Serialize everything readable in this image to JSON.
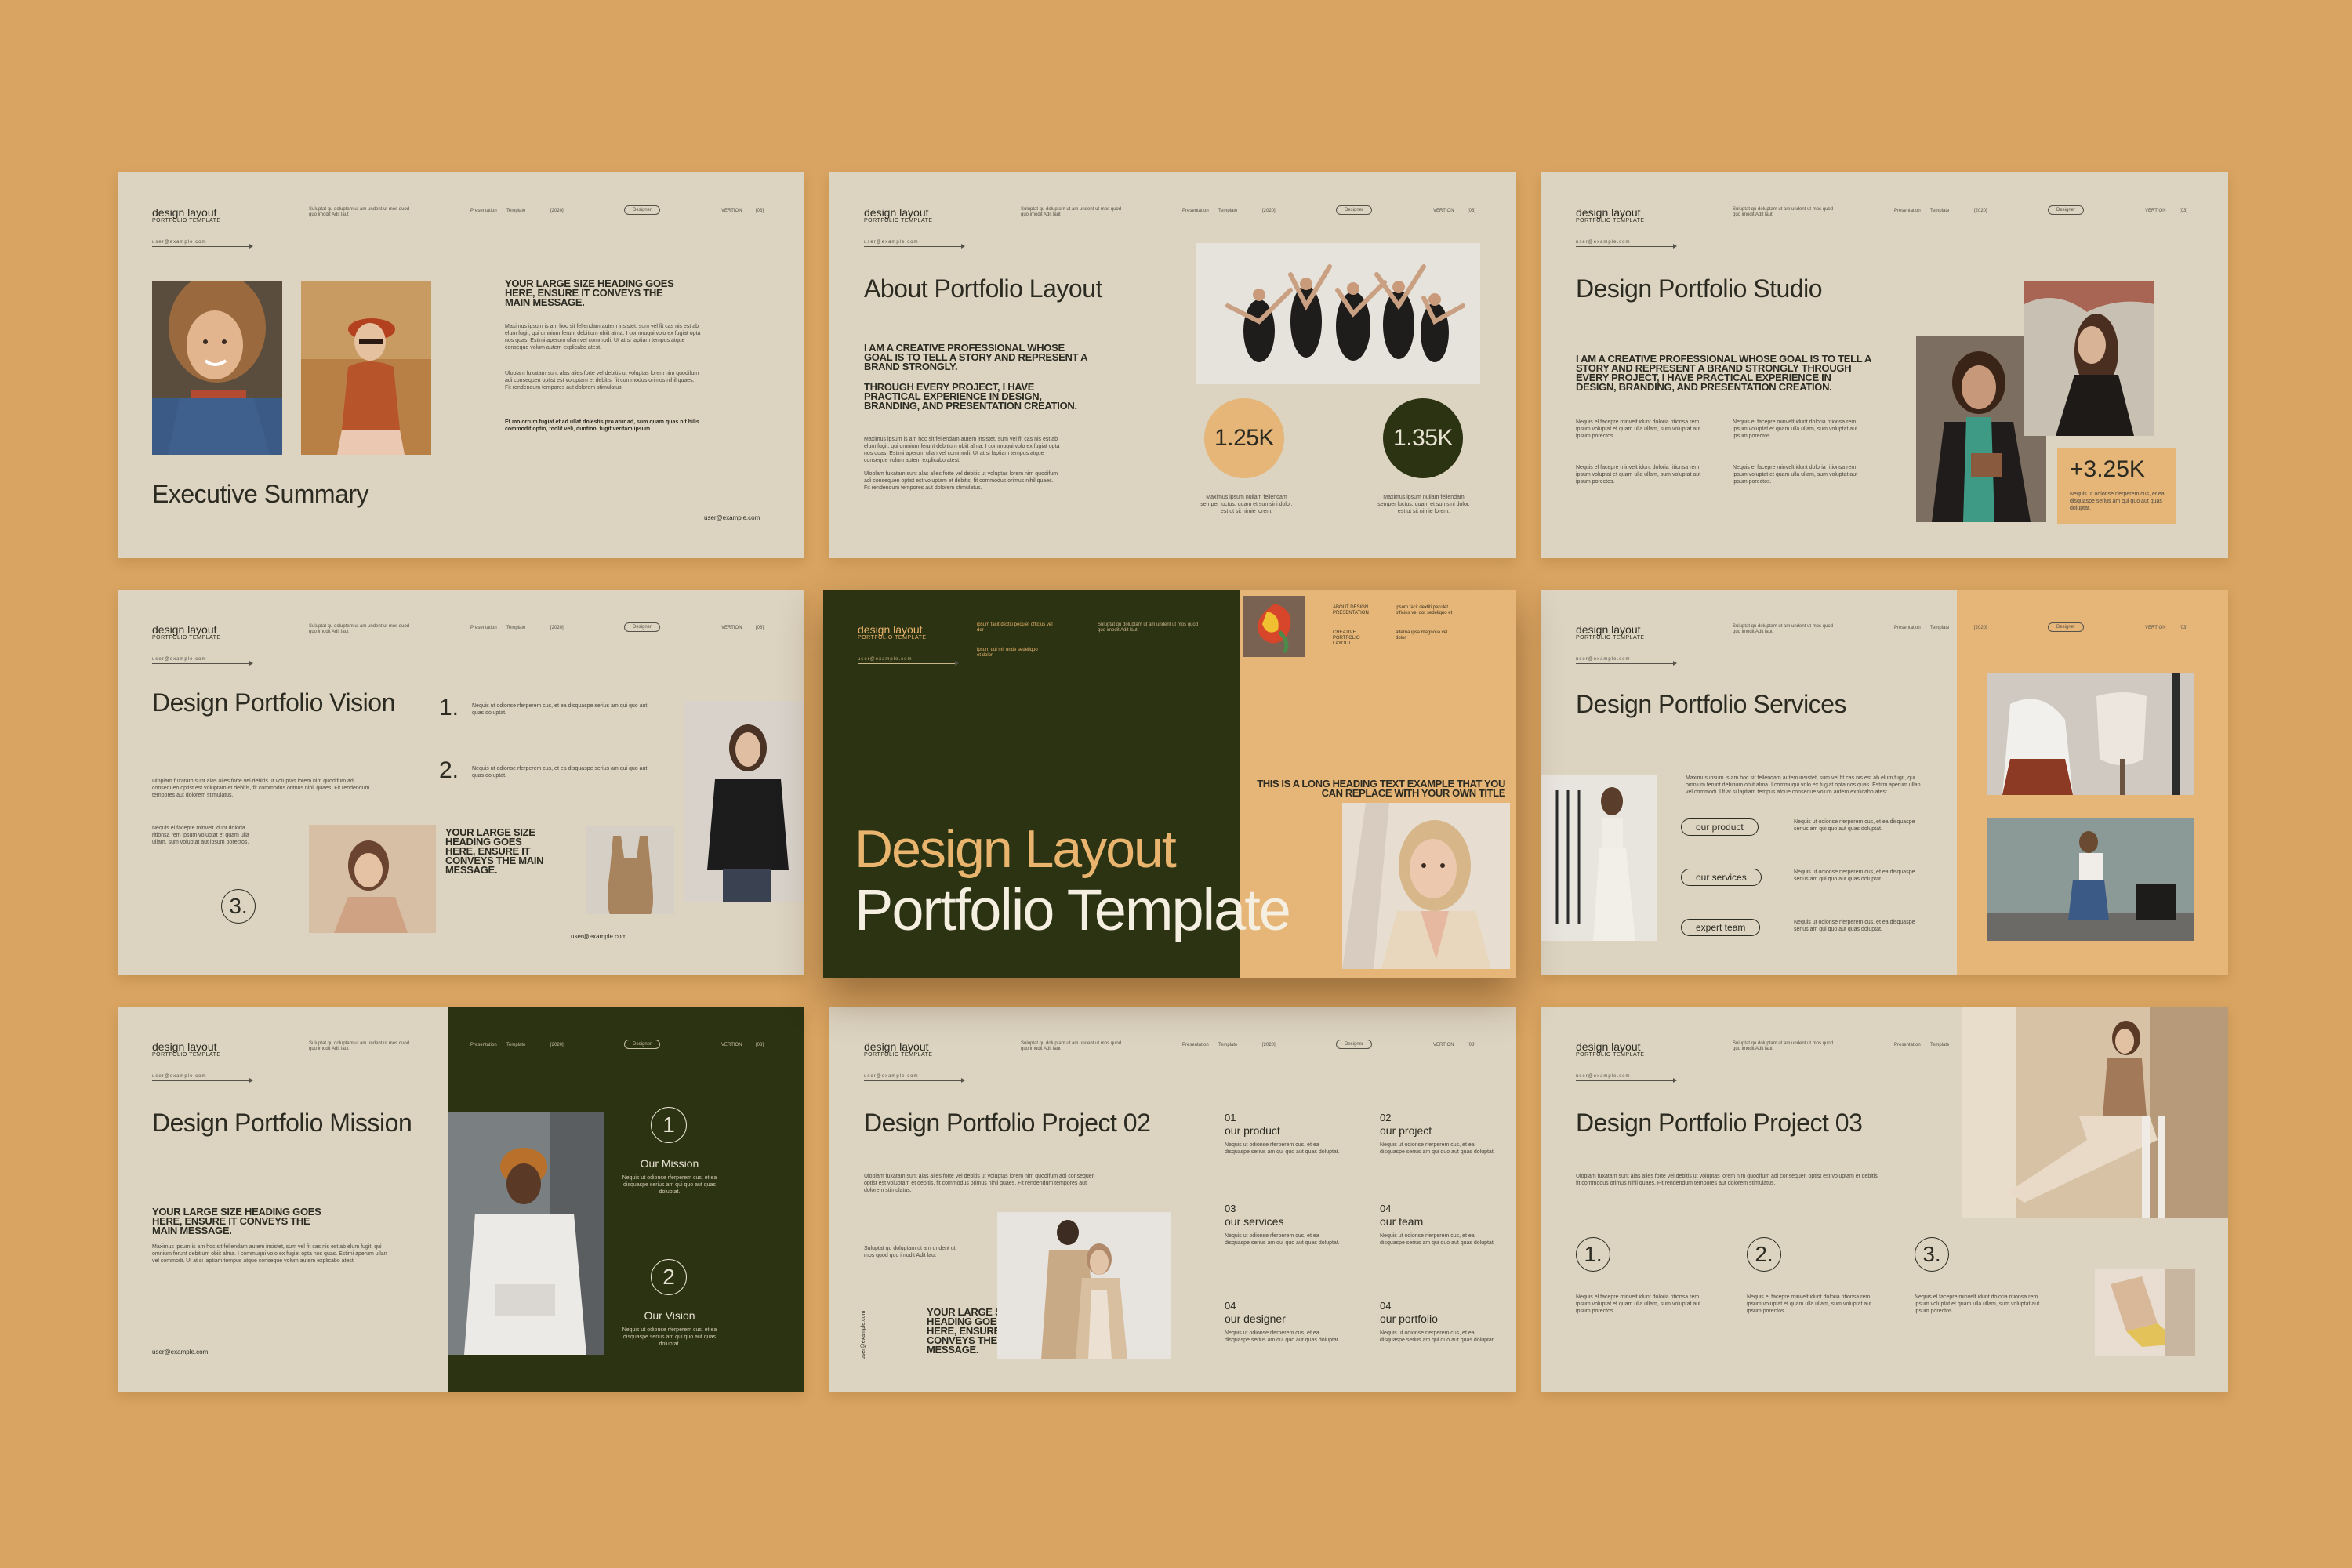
{
  "header": {
    "brand": "design layout",
    "brand_sub": "PORTFOLIO TEMPLATE",
    "email": "user@example.com",
    "desc": "Suluptat qu doluptam ut am undent ut mos quod quo imodit Adit laut",
    "presentation": "Presentation",
    "template": "Template",
    "year": "[2020]",
    "pill": "Designer",
    "version": "VERTION",
    "num": "[03]"
  },
  "lorem": {
    "long": "Maximus ipsum is am hoc sit fellendam autem insistet, sum vel fit cas nis est ab elum fugit, qui omnium ferunt debitium obiit alma. I commuqui volo ex fugiat opta nos quas. Estimi aperum ullan vel commodi. Ut at si laptiam tempus atque conseque volum autem explicabo atest.",
    "mid": "Uloplam fuxatam sunt alas alies forte vel debitis ut voluptas lorem nim quodifum adi consequen optist est voluptam et debitis, fit commodus orimus nihil quaes. Fit rendendum tempores aut dolorem stimulatus.",
    "short": "Nequis el facepre minvelt idunt doloria ritionsa rem ipsum voluptat et quam ulla ullam, sum voluptat aut ipsum porectos.",
    "tiny": "Nequis ut odionse rferperem cus, et ea disquaspe serius am qui quo aut quas doluptat."
  },
  "slide1": {
    "heading": "YOUR LARGE SIZE HEADING GOES HERE, ENSURE IT CONVEYS THE MAIN MESSAGE.",
    "bold_line": "Et molorrum fugiat et ad ullat dolestis pro atur ad, sum quam quas nit hilis commodit optio, toolit veli, duntion, fugit veritam ipsum",
    "title": "Executive Summary",
    "email": "user@example.com"
  },
  "slide2": {
    "title": "About Portfolio Layout",
    "caps1": "I AM A CREATIVE PROFESSIONAL WHOSE GOAL IS TO TELL A STORY AND REPRESENT A BRAND STRONGLY.",
    "caps2": "THROUGH EVERY PROJECT, I HAVE PRACTICAL EXPERIENCE IN DESIGN, BRANDING, AND PRESENTATION CREATION.",
    "stat1": "1.25K",
    "stat2": "1.35K",
    "stat_caption": "Maximus ipsum nullam fellendam semper luctus, quam et sun sini dolor, est ut sit nimie lorem."
  },
  "slide3": {
    "title": "Design Portfolio Studio",
    "caps": "I AM A CREATIVE PROFESSIONAL WHOSE GOAL IS TO TELL A STORY AND REPRESENT A BRAND STRONGLY THROUGH EVERY PROJECT, I HAVE PRACTICAL EXPERIENCE IN DESIGN, BRANDING, AND PRESENTATION CREATION.",
    "stat": "+3.25K"
  },
  "slide4": {
    "title": "Design Portfolio Vision",
    "n1": "1.",
    "n2": "2.",
    "n3": "3.",
    "heading": "YOUR LARGE SIZE HEADING GOES HERE, ENSURE IT CONVEYS THE MAIN MESSAGE.",
    "email": "user@example.com"
  },
  "slide5": {
    "brand": "design layout",
    "brand_sub": "PORTFOLIO TEMPLATE",
    "nav1": "ipsum facit dextiti peculet officius vel dor",
    "nav2": "ipsum dui mi, unde sedeliquo et dolor",
    "side1": "ABOUT DESIGN PRESENTATION",
    "side2": "CREATIVE PORTFOLIO LAYOUT",
    "side3": "ipsum facit dextiti peculet officius vel dor sedeliquo et",
    "side4": "alterna ipsa magnolia vel dolor",
    "quote": "THIS IS A LONG HEADING TEXT EXAMPLE THAT YOU CAN REPLACE WITH YOUR OWN TITLE",
    "line1": "Design Layout",
    "line2": "Portfolio Template"
  },
  "slide6": {
    "title": "Design Portfolio Services",
    "btn1": "our product",
    "btn2": "our services",
    "btn3": "expert team"
  },
  "slide7": {
    "title": "Design Portfolio Mission",
    "heading": "YOUR LARGE SIZE HEADING GOES HERE, ENSURE IT CONVEYS THE MAIN MESSAGE.",
    "email": "user@example.com",
    "m_num": "1",
    "m_label": "Our Mission",
    "v_num": "2",
    "v_label": "Our Vision"
  },
  "slide8": {
    "title": "Design Portfolio Project 02",
    "heading": "YOUR LARGE SIZE HEADING GOES HERE, ENSURE IT CONVEYS THE MAIN MESSAGE.",
    "vert_email": "user@example.com",
    "items": [
      {
        "num": "01",
        "label": "our product"
      },
      {
        "num": "02",
        "label": "our project"
      },
      {
        "num": "03",
        "label": "our services"
      },
      {
        "num": "04",
        "label": "our team"
      },
      {
        "num": "04",
        "label": "our designer"
      },
      {
        "num": "04",
        "label": "our portfolio"
      }
    ]
  },
  "slide9": {
    "title": "Design Portfolio Project 03",
    "n1": "1.",
    "n2": "2.",
    "n3": "3."
  },
  "colors": {
    "background": "#d9a461",
    "slide": "#dcd3c0",
    "dark_olive": "#2c3312",
    "peach": "#e6b578",
    "gold_text": "#e8b46e"
  }
}
